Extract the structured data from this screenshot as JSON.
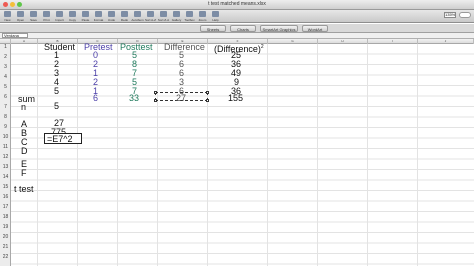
{
  "window": {
    "title": "t test matched means.xlsx",
    "colors": {
      "close": "#ee5a52",
      "minimize": "#f5bf3a",
      "zoom": "#5fc649"
    }
  },
  "toolbar": {
    "buttons": [
      "New",
      "Open",
      "Save",
      "Print",
      "Import",
      "Copy",
      "Paste",
      "Format",
      "Undo",
      "Redo",
      "AutoSum",
      "Sort A-Z",
      "Sort Z-A",
      "Gallery",
      "Toolbox",
      "Zoom",
      "Help"
    ],
    "zoom": "135%"
  },
  "ribbon": {
    "tabs": [
      "Sheets",
      "Charts",
      "SmartArt Graphics",
      "WordArt"
    ]
  },
  "formula_bar": {
    "name_box": "Verdana"
  },
  "columns": [
    "A",
    "B",
    "C",
    "D",
    "E",
    "F",
    "G",
    "H",
    "I",
    "J"
  ],
  "rows": [
    "1",
    "2",
    "3",
    "4",
    "5",
    "6",
    "7",
    "8",
    "9",
    "10",
    "11",
    "12",
    "13",
    "14",
    "15",
    "16",
    "17",
    "18",
    "19",
    "20",
    "21",
    "22"
  ],
  "sheet": {
    "headers": {
      "student": "Student",
      "pretest": "Pretest",
      "posttest": "Posttest",
      "difference": "Difference",
      "diff_squared": "(Difference)",
      "exp": "2"
    },
    "students": [
      "1",
      "2",
      "3",
      "4",
      "5"
    ],
    "pretest": [
      "0",
      "2",
      "1",
      "2",
      "1"
    ],
    "posttest": [
      "5",
      "8",
      "7",
      "5",
      "7"
    ],
    "difference": [
      "5",
      "6",
      "6",
      "3",
      "6"
    ],
    "diff_squared": [
      "25",
      "36",
      "49",
      "9",
      "36"
    ],
    "sum_label": "sum",
    "sums": {
      "pretest": "6",
      "posttest": "33",
      "difference": "27",
      "diff_squared": "155"
    },
    "n_label": "n",
    "n_value": "5",
    "labels": {
      "A": "A",
      "B": "B",
      "C": "C",
      "D": "D",
      "E": "E",
      "F": "F",
      "t_test": "t test"
    },
    "values": {
      "A": "27",
      "B": "775"
    },
    "formula": "=E7^2"
  }
}
